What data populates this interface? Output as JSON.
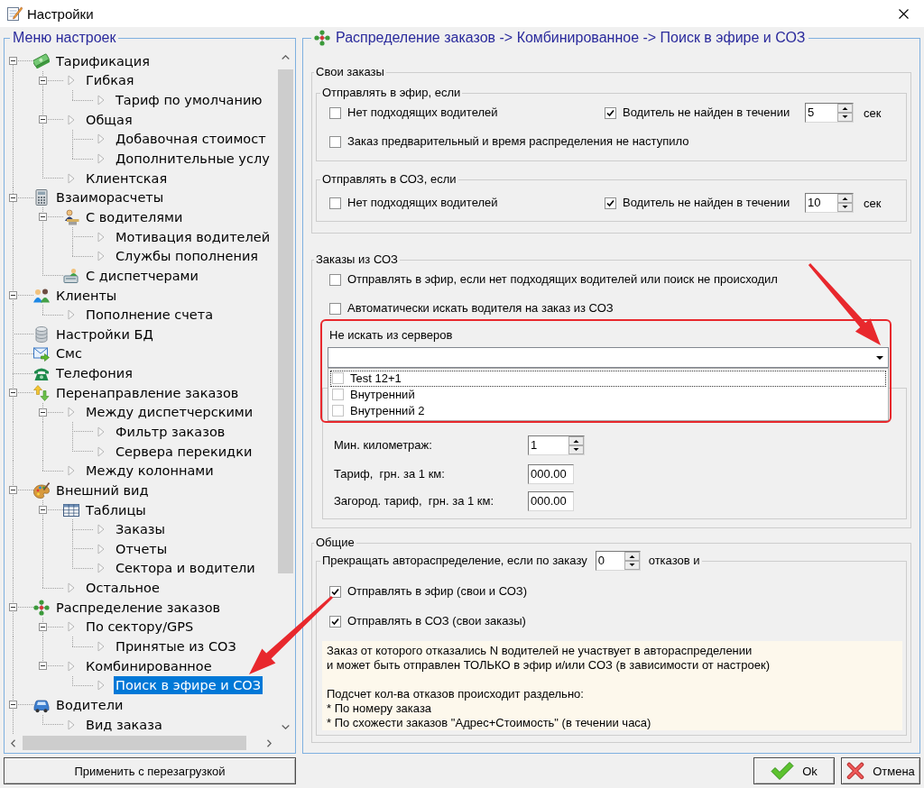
{
  "window": {
    "title": "Настройки"
  },
  "menu": {
    "title": "Меню настроек",
    "tree": [
      {
        "label": "Тарификация",
        "kind": "section",
        "selected": false,
        "expanded": true,
        "children": [
          {
            "label": "Гибкая",
            "kind": "page",
            "selected": false,
            "expanded": true,
            "children": [
              {
                "label": "Тариф по умолчанию",
                "kind": "page",
                "selected": false
              }
            ]
          },
          {
            "label": "Общая",
            "kind": "page",
            "selected": false,
            "expanded": true,
            "children": [
              {
                "label": "Добавочная стоимост",
                "kind": "page",
                "selected": false
              },
              {
                "label": "Дополнительные услу",
                "kind": "page",
                "selected": false
              }
            ]
          },
          {
            "label": "Клиентская",
            "kind": "page",
            "selected": false
          }
        ]
      },
      {
        "label": "Взаиморасчеты",
        "kind": "section",
        "selected": false,
        "expanded": true,
        "children": [
          {
            "label": "С водителями",
            "kind": "section",
            "selected": false,
            "expanded": true,
            "children": [
              {
                "label": "Мотивация водителей",
                "kind": "page",
                "selected": false
              },
              {
                "label": "Службы пополнения",
                "kind": "page",
                "selected": false
              }
            ]
          },
          {
            "label": "С диспетчерами",
            "kind": "section",
            "selected": false
          }
        ]
      },
      {
        "label": "Клиенты",
        "kind": "section",
        "selected": false,
        "expanded": true,
        "children": [
          {
            "label": "Пополнение счета",
            "kind": "page",
            "selected": false
          }
        ]
      },
      {
        "label": "Настройки БД",
        "kind": "section",
        "selected": false
      },
      {
        "label": "Смс",
        "kind": "section",
        "selected": false
      },
      {
        "label": "Телефония",
        "kind": "section",
        "selected": false
      },
      {
        "label": "Перенаправление заказов",
        "kind": "section",
        "selected": false,
        "expanded": true,
        "children": [
          {
            "label": "Между диспетчерскими",
            "kind": "page",
            "selected": false,
            "expanded": true,
            "children": [
              {
                "label": "Фильтр заказов",
                "kind": "page",
                "selected": false
              },
              {
                "label": "Сервера перекидки",
                "kind": "page",
                "selected": false
              }
            ]
          },
          {
            "label": "Между колоннами",
            "kind": "page",
            "selected": false
          }
        ]
      },
      {
        "label": "Внешний вид",
        "kind": "section",
        "selected": false,
        "expanded": true,
        "children": [
          {
            "label": "Таблицы",
            "kind": "section",
            "selected": false,
            "expanded": true,
            "children": [
              {
                "label": "Заказы",
                "kind": "page",
                "selected": false
              },
              {
                "label": "Отчеты",
                "kind": "page",
                "selected": false
              },
              {
                "label": "Сектора и водители",
                "kind": "page",
                "selected": false
              }
            ]
          },
          {
            "label": "Остальное",
            "kind": "page",
            "selected": false
          }
        ]
      },
      {
        "label": "Распределение заказов",
        "kind": "section",
        "selected": false,
        "expanded": true,
        "children": [
          {
            "label": "По сектору/GPS",
            "kind": "page",
            "selected": false,
            "expanded": true,
            "children": [
              {
                "label": "Принятые из СОЗ",
                "kind": "page",
                "selected": false
              }
            ]
          },
          {
            "label": "Комбинированное",
            "kind": "page",
            "selected": false,
            "expanded": true,
            "children": [
              {
                "label": "Поиск в эфире и СОЗ",
                "kind": "page",
                "selected": true
              }
            ]
          }
        ]
      },
      {
        "label": "Водители",
        "kind": "section",
        "selected": false,
        "expanded": true,
        "children": [
          {
            "label": "Вид заказа",
            "kind": "page",
            "selected": false
          }
        ]
      }
    ]
  },
  "apply_button": "Применить с перезагрузкой",
  "breadcrumb": "Распределение заказов -> Комбинированное -> Поиск в эфире и СОЗ",
  "own_orders": {
    "title": "Свои заказы",
    "groups": [
      {
        "title": "Отправлять в эфир, если",
        "no_drivers": {
          "label": "Нет подходящих водителей",
          "checked": false
        },
        "timeout": {
          "label": "Водитель не найден в течении",
          "checked": true,
          "value": "5",
          "unit": "сек"
        },
        "extra": [
          {
            "label": "Заказ предварительный и время распределения не наступило",
            "checked": false
          }
        ]
      },
      {
        "title": "Отправлять в СОЗ, если",
        "no_drivers": {
          "label": "Нет подходящих водителей",
          "checked": false
        },
        "timeout": {
          "label": "Водитель не найден в течении",
          "checked": true,
          "value": "10",
          "unit": "сек"
        }
      }
    ]
  },
  "soz_orders": {
    "title": "Заказы из СОЗ",
    "options": [
      {
        "label": "Отправлять в эфир, если нет подходящих водителей или поиск не происходил",
        "checked": false
      },
      {
        "label": "Автоматически искать водителя на заказ из СОЗ",
        "checked": false
      }
    ],
    "exclude_servers": {
      "label": "Не искать из серверов",
      "expanded": true,
      "items": [
        {
          "label": "Test 12+1",
          "checked": false,
          "selected": true
        },
        {
          "label": "Внутренний",
          "checked": false,
          "selected": false
        },
        {
          "label": "Внутренний 2",
          "checked": false,
          "selected": false
        }
      ]
    },
    "tariff_fields": [
      {
        "label": "Мин. километраж:",
        "value": "1",
        "kind": "spin"
      },
      {
        "label": "Тариф,  грн. за 1 км:",
        "value": "000.00",
        "kind": "text"
      },
      {
        "label": "Загород. тариф,  грн. за 1 км:",
        "value": "000.00",
        "kind": "text"
      }
    ]
  },
  "common": {
    "title": "Общие",
    "stop": {
      "before": "Прекращать автораспределение, если по заказу",
      "value": "0",
      "after": "отказов и"
    },
    "options": [
      {
        "label": "Отправлять в эфир (свои и СОЗ)",
        "checked": true
      },
      {
        "label": "Отправлять в СОЗ (свои заказы)",
        "checked": true
      }
    ],
    "note": [
      "Заказ от которого отказались N водителей не участвует в автораспределении\nи может быть отправлен ТОЛЬКО в эфир и/или СОЗ (в зависимости от настроек)",
      "Подсчет кол-ва отказов происходит раздельно:\n* По номеру заказа\n* По схожести заказов \"Адрес+Стоимость\" (в течении часа)"
    ]
  },
  "buttons": {
    "ok": "Ok",
    "cancel": "Отмена"
  }
}
